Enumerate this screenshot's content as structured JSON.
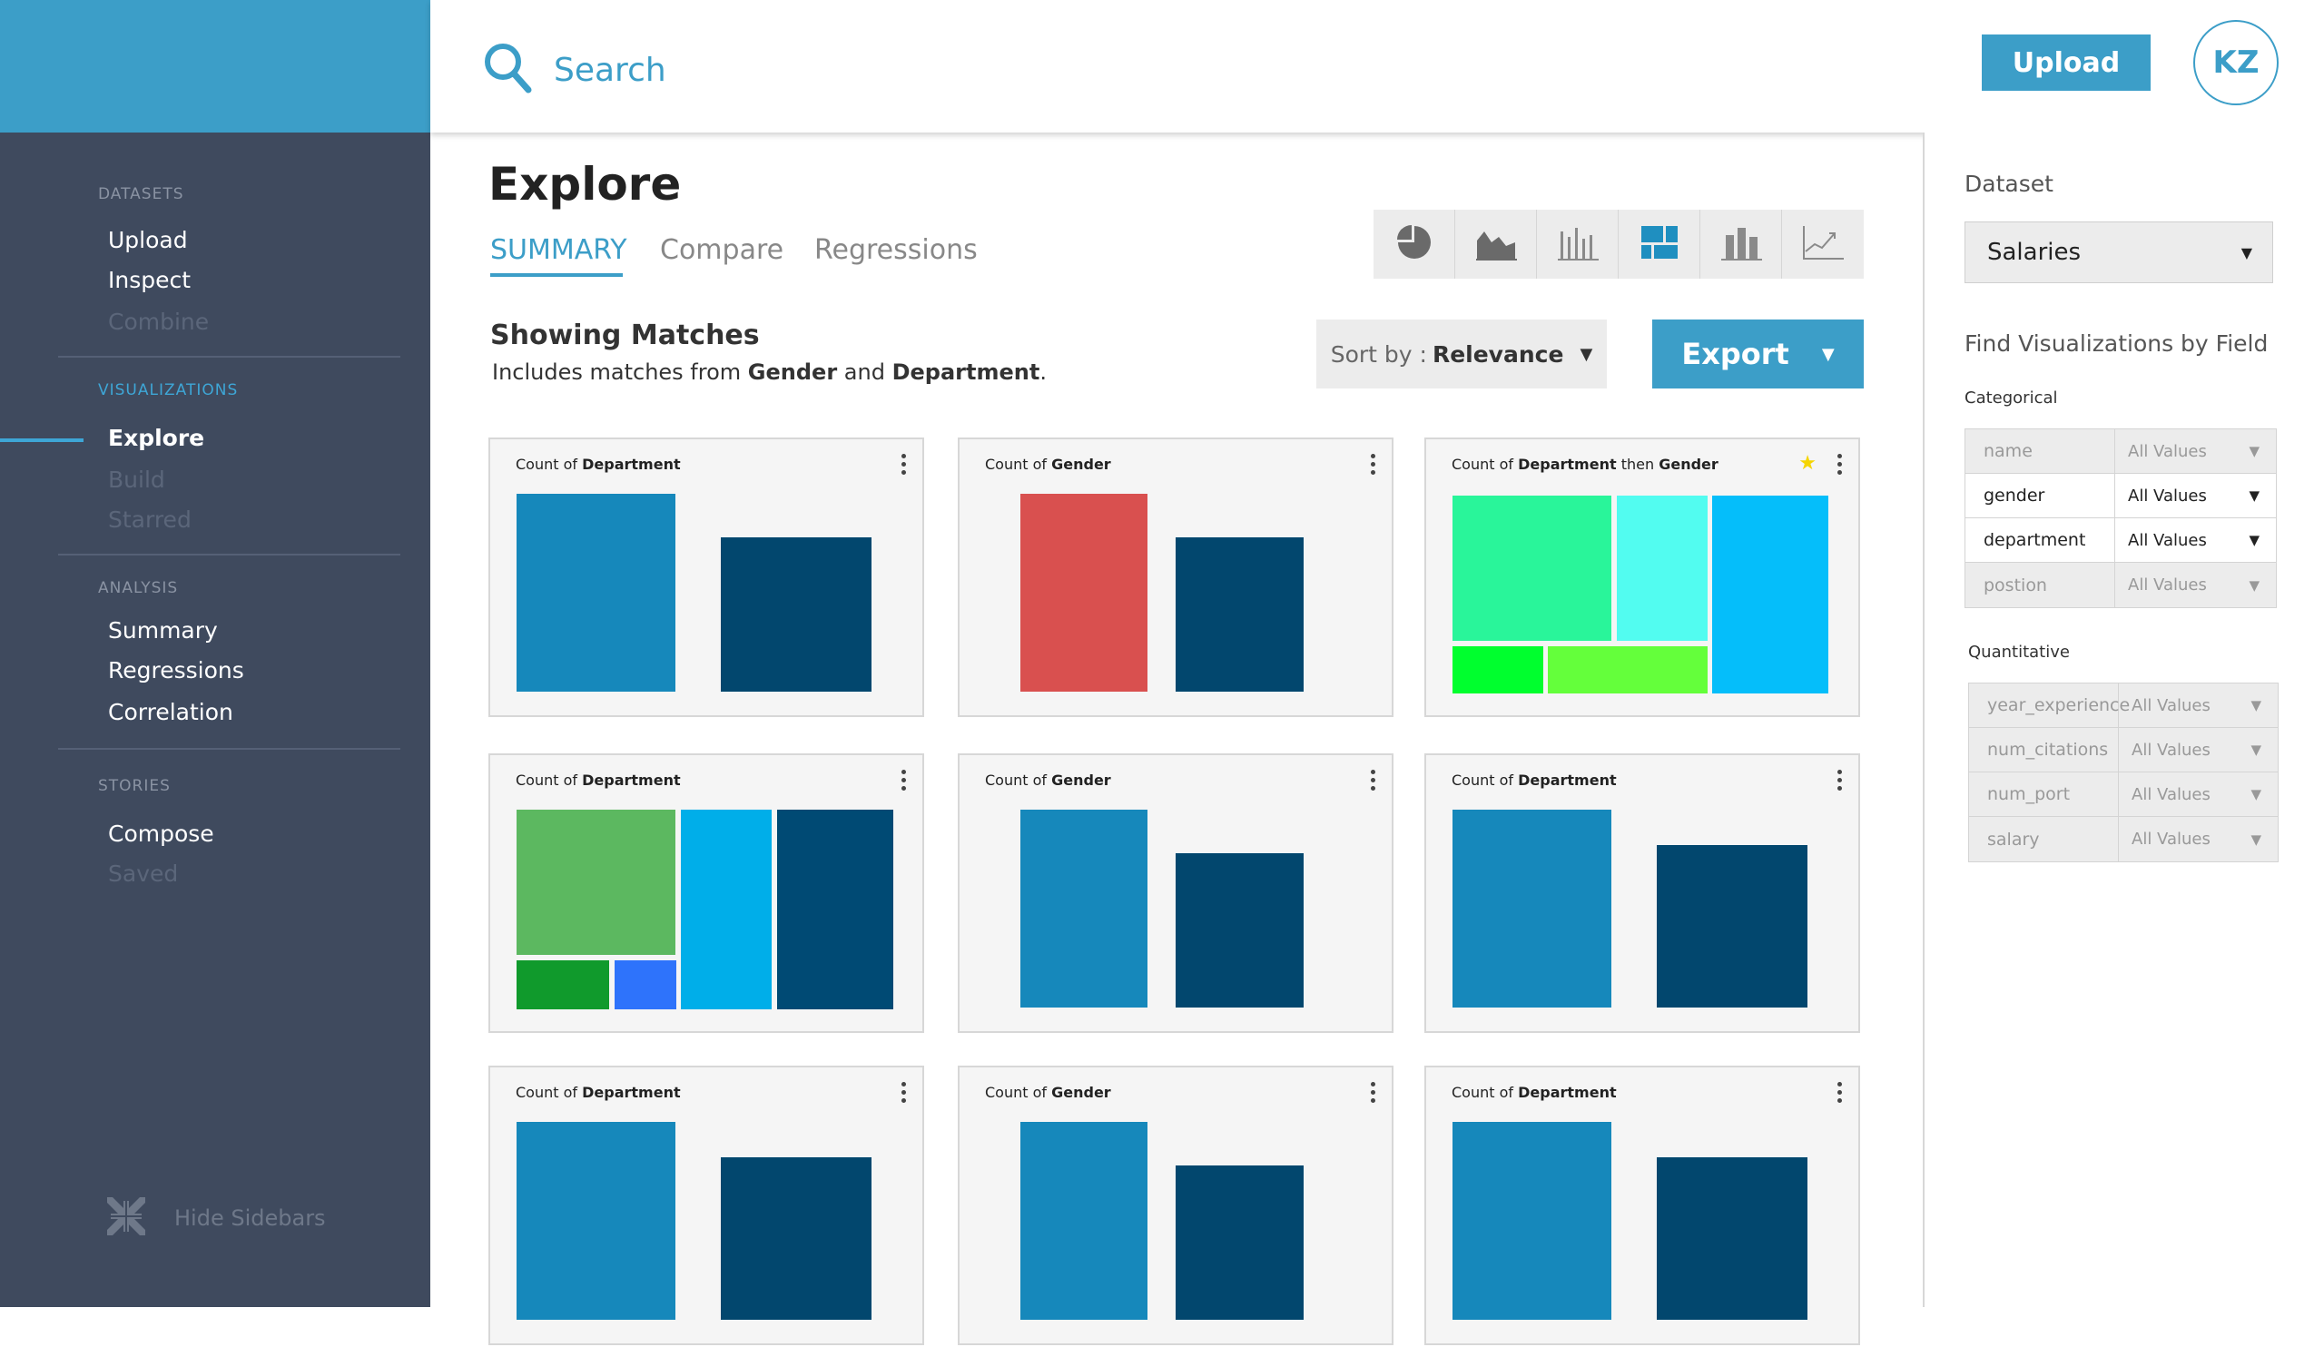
{
  "search": {
    "placeholder": "Search"
  },
  "topbar": {
    "upload_label": "Upload",
    "avatar_initials": "KZ"
  },
  "sidebar": {
    "datasets_heading": "DATASETS",
    "datasets": [
      "Upload",
      "Inspect",
      "Combine"
    ],
    "visualizations_heading": "VISUALIZATIONS",
    "visualizations": [
      "Explore",
      "Build",
      "Starred"
    ],
    "analysis_heading": "ANALYSIS",
    "analysis": [
      "Summary",
      "Regressions",
      "Correlation"
    ],
    "stories_heading": "STORIES",
    "stories": [
      "Compose",
      "Saved"
    ],
    "hide_label": "Hide Sidebars"
  },
  "main": {
    "title": "Explore",
    "tabs": [
      "SUMMARY",
      "Compare",
      "Regressions"
    ],
    "matches_title": "Showing Matches",
    "matches_prefix": "Includes matches from",
    "matches_field1": "Gender",
    "matches_and": "and",
    "matches_field2": "Department",
    "matches_suffix": ".",
    "sort_prefix": "Sort by :",
    "sort_value": "Relevance",
    "export_label": "Export",
    "viz_types": [
      "pie-chart-icon",
      "area-chart-icon",
      "bar-chart-icon",
      "treemap-icon",
      "column-chart-icon",
      "line-chart-icon"
    ]
  },
  "cards": [
    {
      "prefix": "Count of",
      "field": "Department",
      "type": "bar",
      "colors": [
        "#1688bb",
        "#02476e"
      ],
      "values": [
        1.0,
        0.78
      ]
    },
    {
      "prefix": "Count of",
      "field": "Gender",
      "type": "bar",
      "colors": [
        "#d9504f",
        "#02476e"
      ],
      "values": [
        1.0,
        0.78
      ]
    },
    {
      "prefix": "Count of",
      "field": "Department",
      "then": "then",
      "field2": "Gender",
      "type": "treemap",
      "starred": true,
      "colors": [
        "#29f59a",
        "#52fcf0",
        "#05befa",
        "#00ff2e",
        "#64ff3b"
      ]
    },
    {
      "prefix": "Count of",
      "field": "Department",
      "type": "treemap",
      "colors": [
        "#5cb860",
        "#00aee9",
        "#004a74",
        "#109a2c",
        "#2e73fb"
      ]
    },
    {
      "prefix": "Count of",
      "field": "Gender",
      "type": "bar",
      "colors": [
        "#1688bb",
        "#02476e"
      ],
      "values": [
        1.0,
        0.78
      ]
    },
    {
      "prefix": "Count of",
      "field": "Department",
      "type": "bar",
      "colors": [
        "#1688bb",
        "#02476e"
      ],
      "values": [
        1.0,
        0.82
      ]
    },
    {
      "prefix": "Count of",
      "field": "Department",
      "type": "bar",
      "colors": [
        "#1688bb",
        "#02476e"
      ],
      "values": [
        1.0,
        0.82
      ]
    },
    {
      "prefix": "Count of",
      "field": "Gender",
      "type": "bar",
      "colors": [
        "#1688bb",
        "#02476e"
      ],
      "values": [
        1.0,
        0.78
      ]
    },
    {
      "prefix": "Count of",
      "field": "Department",
      "type": "bar",
      "colors": [
        "#1688bb",
        "#02476e"
      ],
      "values": [
        1.0,
        0.82
      ]
    }
  ],
  "right_panel": {
    "dataset_label": "Dataset",
    "dataset_value": "Salaries",
    "find_label": "Find Visualizations by Field",
    "categorical_label": "Categorical",
    "categorical": [
      {
        "name": "name",
        "value": "All Values",
        "active": false
      },
      {
        "name": "gender",
        "value": "All Values",
        "active": true
      },
      {
        "name": "department",
        "value": "All Values",
        "active": true
      },
      {
        "name": "postion",
        "value": "All Values",
        "active": false
      }
    ],
    "quantitative_label": "Quantitative",
    "quantitative": [
      {
        "name": "year_experience",
        "value": "All Values",
        "active": false
      },
      {
        "name": "num_citations",
        "value": "All Values",
        "active": false
      },
      {
        "name": "num_port",
        "value": "All Values",
        "active": false
      },
      {
        "name": "salary",
        "value": "All Values",
        "active": false
      }
    ]
  },
  "colors": {
    "accent": "#3c9ec8",
    "sidebar": "#3f4a5e",
    "star": "#f5d500"
  }
}
